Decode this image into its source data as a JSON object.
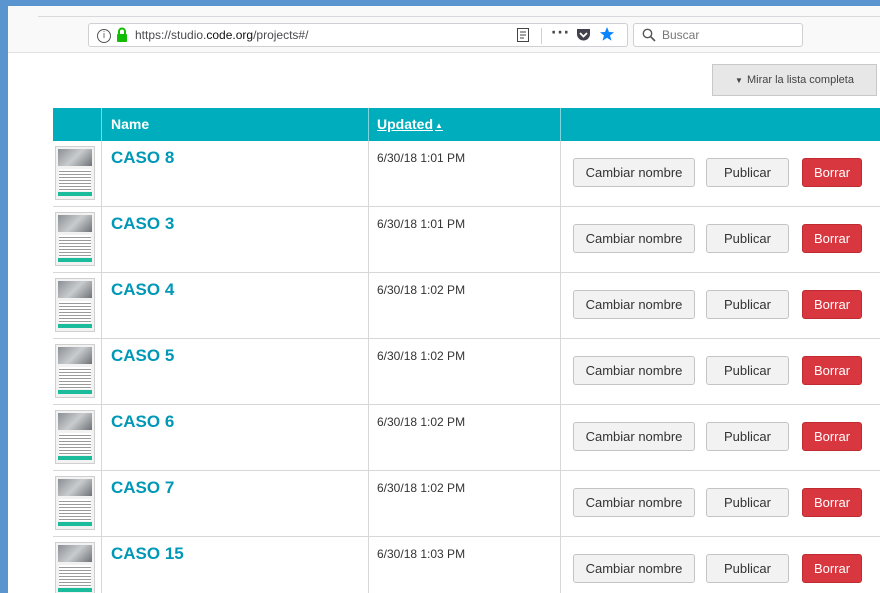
{
  "browser": {
    "url_prefix": "https://studio.",
    "url_domain": "code.org",
    "url_suffix": "/projects#/",
    "search_placeholder": "Buscar",
    "more_label": "···",
    "info_label": "i"
  },
  "list_button": {
    "caret": "▼",
    "label": "Mirar la lista completa"
  },
  "table": {
    "headers": {
      "name": "Name",
      "updated": "Updated",
      "sort_indicator": "▲"
    },
    "buttons": {
      "rename": "Cambiar nombre",
      "publish": "Publicar",
      "delete": "Borrar"
    },
    "rows": [
      {
        "name": "CASO 8",
        "updated": "6/30/18 1:01 PM"
      },
      {
        "name": "CASO 3",
        "updated": "6/30/18 1:01 PM"
      },
      {
        "name": "CASO 4",
        "updated": "6/30/18 1:02 PM"
      },
      {
        "name": "CASO 5",
        "updated": "6/30/18 1:02 PM"
      },
      {
        "name": "CASO 6",
        "updated": "6/30/18 1:02 PM"
      },
      {
        "name": "CASO 7",
        "updated": "6/30/18 1:02 PM"
      },
      {
        "name": "CASO 15",
        "updated": "6/30/18 1:03 PM"
      }
    ]
  },
  "colors": {
    "header": "#00adbc",
    "link": "#0098b7",
    "delete": "#d9373f",
    "lock": "#12bc00",
    "star": "#0a84ff"
  }
}
